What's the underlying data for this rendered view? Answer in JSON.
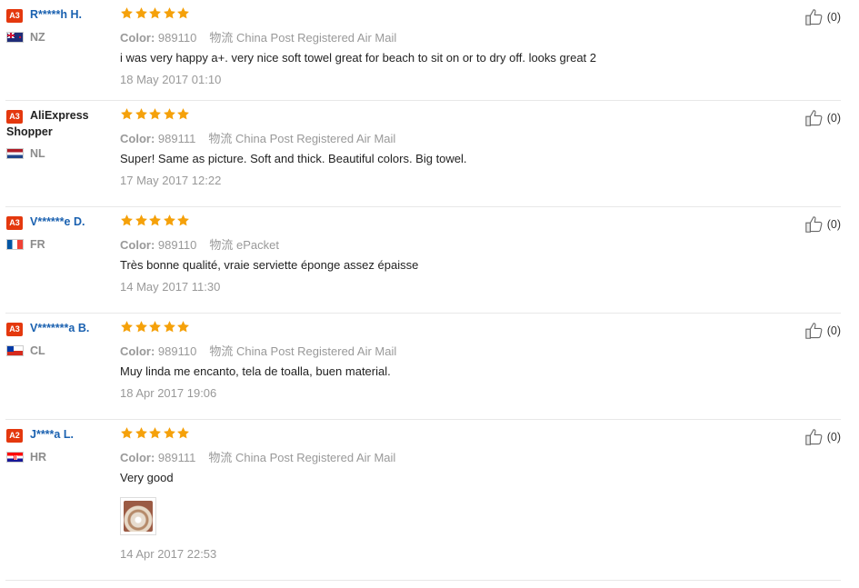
{
  "labels": {
    "color": "Color:",
    "shipping": "物流"
  },
  "reviews": [
    {
      "badge": "A3",
      "user": "R*****h H.",
      "country": "NZ",
      "stars": 5,
      "color": "989110",
      "shipping": "China Post Registered Air Mail",
      "text": "i was very happy a+. very nice soft towel great for beach to sit on or to dry off. looks great 2",
      "date": "18 May 2017 01:10",
      "likes": "(0)"
    },
    {
      "badge": "A3",
      "user": "AliExpress",
      "user2": "Shopper",
      "country": "NL",
      "stars": 5,
      "color": "989111",
      "shipping": "China Post Registered Air Mail",
      "text": "Super! Same as picture. Soft and thick. Beautiful colors. Big towel.",
      "date": "17 May 2017 12:22",
      "likes": "(0)"
    },
    {
      "badge": "A3",
      "user": "V******e D.",
      "country": "FR",
      "stars": 5,
      "color": "989110",
      "shipping": "ePacket",
      "text": "Très bonne qualité, vraie serviette éponge assez épaisse",
      "date": "14 May 2017 11:30",
      "likes": "(0)"
    },
    {
      "badge": "A3",
      "user": "V*******a B.",
      "country": "CL",
      "stars": 5,
      "color": "989110",
      "shipping": "China Post Registered Air Mail",
      "text": "Muy linda me encanto, tela de toalla, buen material.",
      "date": "18 Apr 2017 19:06",
      "likes": "(0)"
    },
    {
      "badge": "A2",
      "user": "J****a L.",
      "country": "HR",
      "stars": 5,
      "color": "989111",
      "shipping": "China Post Registered Air Mail",
      "text": "Very good",
      "date": "14 Apr 2017 22:53",
      "likes": "(0)"
    }
  ],
  "colors": {
    "star": "#f5a10a",
    "badge": "#e4380e",
    "link": "#1a61b0"
  }
}
